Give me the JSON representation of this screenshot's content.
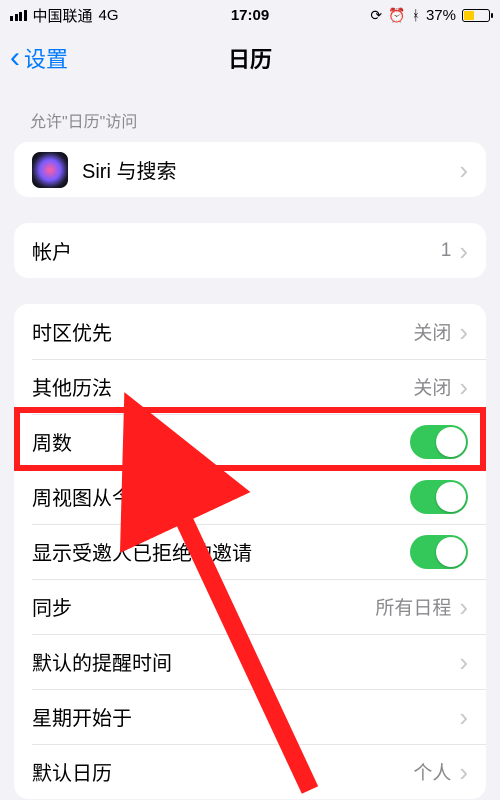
{
  "status": {
    "carrier": "中国联通",
    "network": "4G",
    "time": "17:09",
    "battery_pct": "37%"
  },
  "nav": {
    "back_label": "设置",
    "title": "日历"
  },
  "section_allow_label": "允许\"日历\"访问",
  "rows": {
    "siri": "Siri 与搜索",
    "accounts_label": "帐户",
    "accounts_value": "1",
    "tz_label": "时区优先",
    "tz_value": "关闭",
    "altcal_label": "其他历法",
    "altcal_value": "关闭",
    "weeknum_label": "周数",
    "weekview_label": "周视图从今天开",
    "declined_label": "显示受邀人已拒绝的邀请",
    "sync_label": "同步",
    "sync_value": "所有日程",
    "default_alert_label": "默认的提醒时间",
    "week_start_label": "星期开始于",
    "default_cal_label": "默认日历",
    "default_cal_value": "个人"
  }
}
